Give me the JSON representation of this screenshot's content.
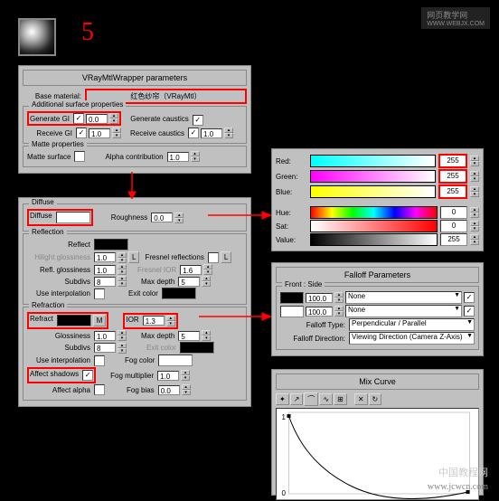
{
  "step": "5",
  "watermark": "网页教学网",
  "watermarkUrl": "WWW.WEBJX.COM",
  "footer1": "中国教程网",
  "footer2": "www.jcwcn.com",
  "vray": {
    "header": "VRayMtlWrapper parameters",
    "baseMtlLbl": "Base material:",
    "baseMtl": "红色纱帘（VRayMtl）",
    "addSurf": "Additional surface properties",
    "genGI": "Generate GI",
    "genGIVal": "0.0",
    "genCau": "Generate caustics",
    "recGI": "Receive GI",
    "recGIVal": "1.0",
    "recCau": "Receive caustics",
    "recCauVal": "1.0",
    "matte": "Matte properties",
    "matteSurf": "Matte surface",
    "alphaContr": "Alpha contribution",
    "alphaVal": "1.0"
  },
  "diffuse": {
    "grp": "Diffuse",
    "lbl": "Diffuse",
    "rough": "Roughness",
    "roughVal": "0.0"
  },
  "reflection": {
    "grp": "Reflection",
    "reflect": "Reflect",
    "hilight": "Hilight glossiness",
    "hilightVal": "1.0",
    "L": "L",
    "fresRefl": "Fresnel reflections",
    "fresL": "L",
    "reflGloss": "Refl. glossiness",
    "reflGlossVal": "1.0",
    "fresIOR": "Fresnel IOR",
    "fresIORVal": "1.6",
    "subdivs": "Subdivs",
    "subdivsVal": "8",
    "maxDepth": "Max depth",
    "maxDepthVal": "5",
    "useInterp": "Use interpolation",
    "exitColor": "Exit color"
  },
  "refraction": {
    "grp": "Refraction",
    "refract": "Refract",
    "M": "M",
    "IOR": "IOR",
    "IORVal": "1.3",
    "gloss": "Glossiness",
    "glossVal": "1.0",
    "maxDepth": "Max depth",
    "maxDepthVal": "5",
    "subdivs": "Subdivs",
    "subdivsVal": "8",
    "exitColor": "Exit color",
    "useInterp": "Use interpolation",
    "fogColor": "Fog color",
    "affShadows": "Affect shadows",
    "fogMult": "Fog multiplier",
    "fogMultVal": "1.0",
    "affAlpha": "Affect alpha",
    "fogBias": "Fog bias",
    "fogBiasVal": "0.0"
  },
  "color": {
    "red": "Red:",
    "redVal": "255",
    "green": "Green:",
    "greenVal": "255",
    "blue": "Blue:",
    "blueVal": "255",
    "hue": "Hue:",
    "hueVal": "0",
    "sat": "Sat:",
    "satVal": "0",
    "val": "Value:",
    "valVal": "255"
  },
  "falloff": {
    "header": "Falloff Parameters",
    "frontSide": "Front : Side",
    "v1": "100.0",
    "v2": "100.0",
    "none": "None",
    "typeLbl": "Falloff Type:",
    "type": "Perpendicular / Parallel",
    "dirLbl": "Falloff Direction:",
    "dir": "Viewing Direction (Camera Z-Axis)"
  },
  "curve": {
    "header": "Mix Curve"
  }
}
